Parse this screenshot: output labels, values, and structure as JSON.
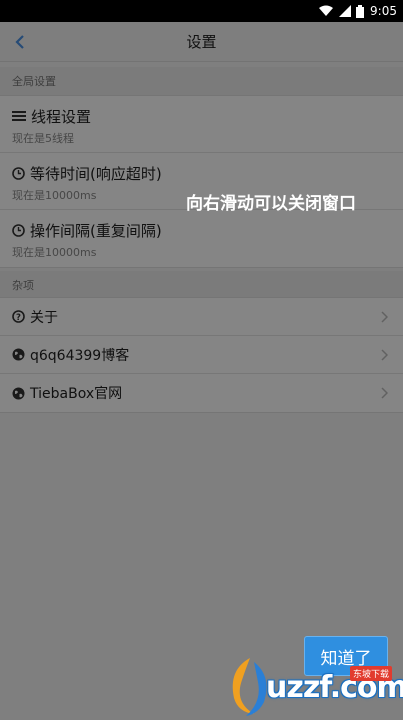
{
  "status_bar": {
    "time": "9:05"
  },
  "header": {
    "title": "设置"
  },
  "sections": {
    "global_label": "全局设置",
    "misc_label": "杂项"
  },
  "global_items": [
    {
      "title": "线程设置",
      "subtitle": "现在是5线程",
      "icon": "list-icon"
    },
    {
      "title": "等待时间(响应超时)",
      "subtitle": "现在是10000ms",
      "icon": "clock-icon"
    },
    {
      "title": "操作间隔(重复间隔)",
      "subtitle": "现在是10000ms",
      "icon": "clock-icon"
    }
  ],
  "misc_items": [
    {
      "label": "关于",
      "icon": "question-circle-icon"
    },
    {
      "label": "q6q64399博客",
      "icon": "globe-icon"
    },
    {
      "label": "TiebaBox官网",
      "icon": "globe-icon"
    }
  ],
  "overlay": {
    "hint": "向右滑动可以关闭窗口",
    "button_label": "知道了"
  },
  "watermark": {
    "text": "uzzf.com",
    "tag": "东坡下载"
  },
  "colors": {
    "accent": "#2f8fe0",
    "back_arrow": "#4a90e2",
    "overlay": "rgba(0,0,0,0.48)"
  }
}
